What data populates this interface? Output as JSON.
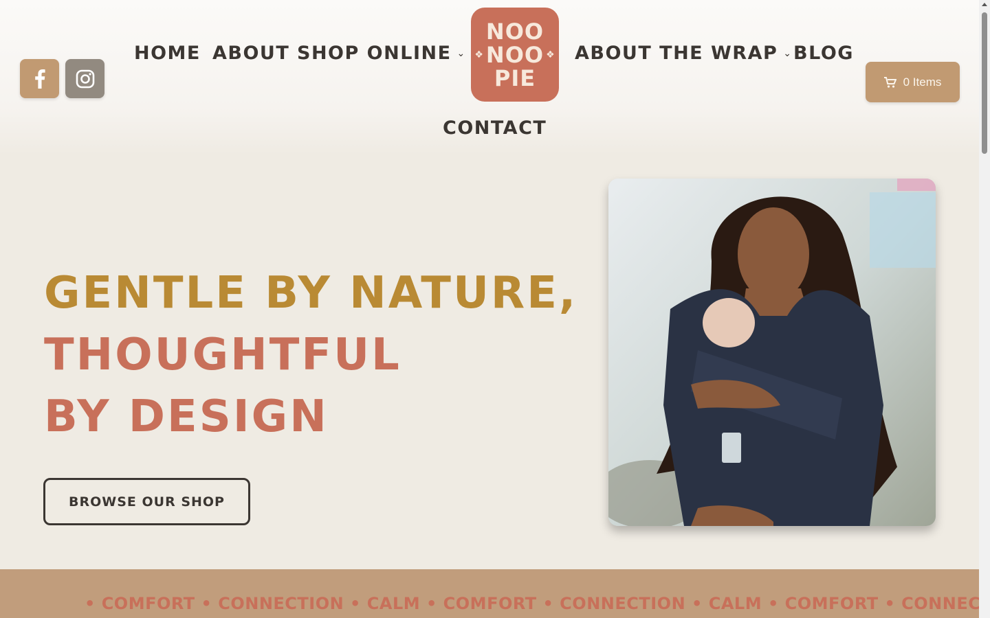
{
  "social": {
    "facebook_icon": "facebook-icon",
    "instagram_icon": "instagram-icon"
  },
  "nav": {
    "home": "Home",
    "about": "About",
    "shop_online": "Shop Online",
    "about_the_wrap": "About The Wrap",
    "blog": "Blog",
    "contact": "Contact"
  },
  "logo": {
    "line1": "NOO",
    "line2": "NOO",
    "line3": "PIE"
  },
  "cart": {
    "label": "0 Items",
    "icon": "cart-icon"
  },
  "hero": {
    "line1": "Gentle by nature,",
    "line2": "thoughtful",
    "line3": "by design",
    "button": "Browse our shop",
    "image": "mother-with-baby-in-wrap-photo"
  },
  "marquee": {
    "text": "• COMFORT • CONNECTION • CALM • COMFORT • CONNECTION • CALM • COMFORT • CONNECTION • CALM • COMFORT • C"
  },
  "colors": {
    "background": "#efebe3",
    "brand_terracotta": "#c8705a",
    "brand_gold": "#b98a34",
    "tan": "#c19a72",
    "dark": "#3b3632"
  }
}
